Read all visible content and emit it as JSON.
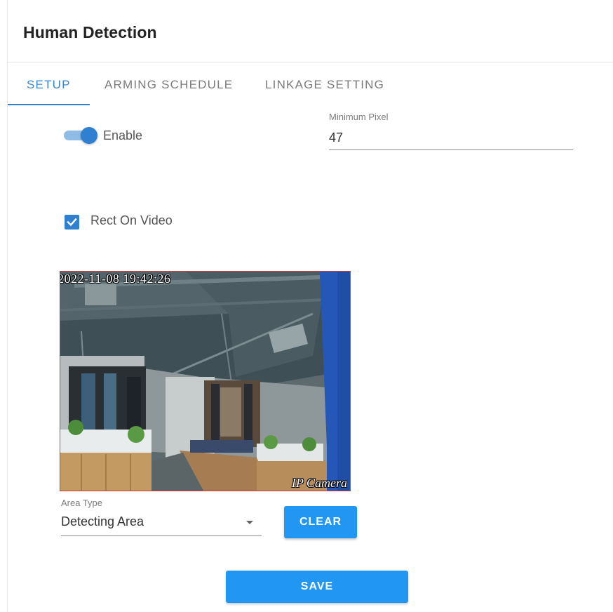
{
  "page": {
    "title": "Human Detection"
  },
  "tabs": [
    {
      "label": "SETUP",
      "active": true
    },
    {
      "label": "ARMING SCHEDULE",
      "active": false
    },
    {
      "label": "LINKAGE SETTING",
      "active": false
    }
  ],
  "setup": {
    "enable": {
      "label": "Enable",
      "checked": true
    },
    "minimum_pixel": {
      "label": "Minimum Pixel",
      "value": "47"
    },
    "rect_on_video": {
      "label": "Rect On Video",
      "checked": true
    },
    "video": {
      "timestamp": "2022-11-08 19:42:26",
      "camera_label": "IP Camera"
    },
    "area_type": {
      "label": "Area Type",
      "value": "Detecting Area"
    },
    "clear_label": "CLEAR",
    "save_label": "SAVE"
  },
  "colors": {
    "accent": "#2f80d1",
    "button": "#2196f3",
    "video_border": "#d23b3b"
  }
}
